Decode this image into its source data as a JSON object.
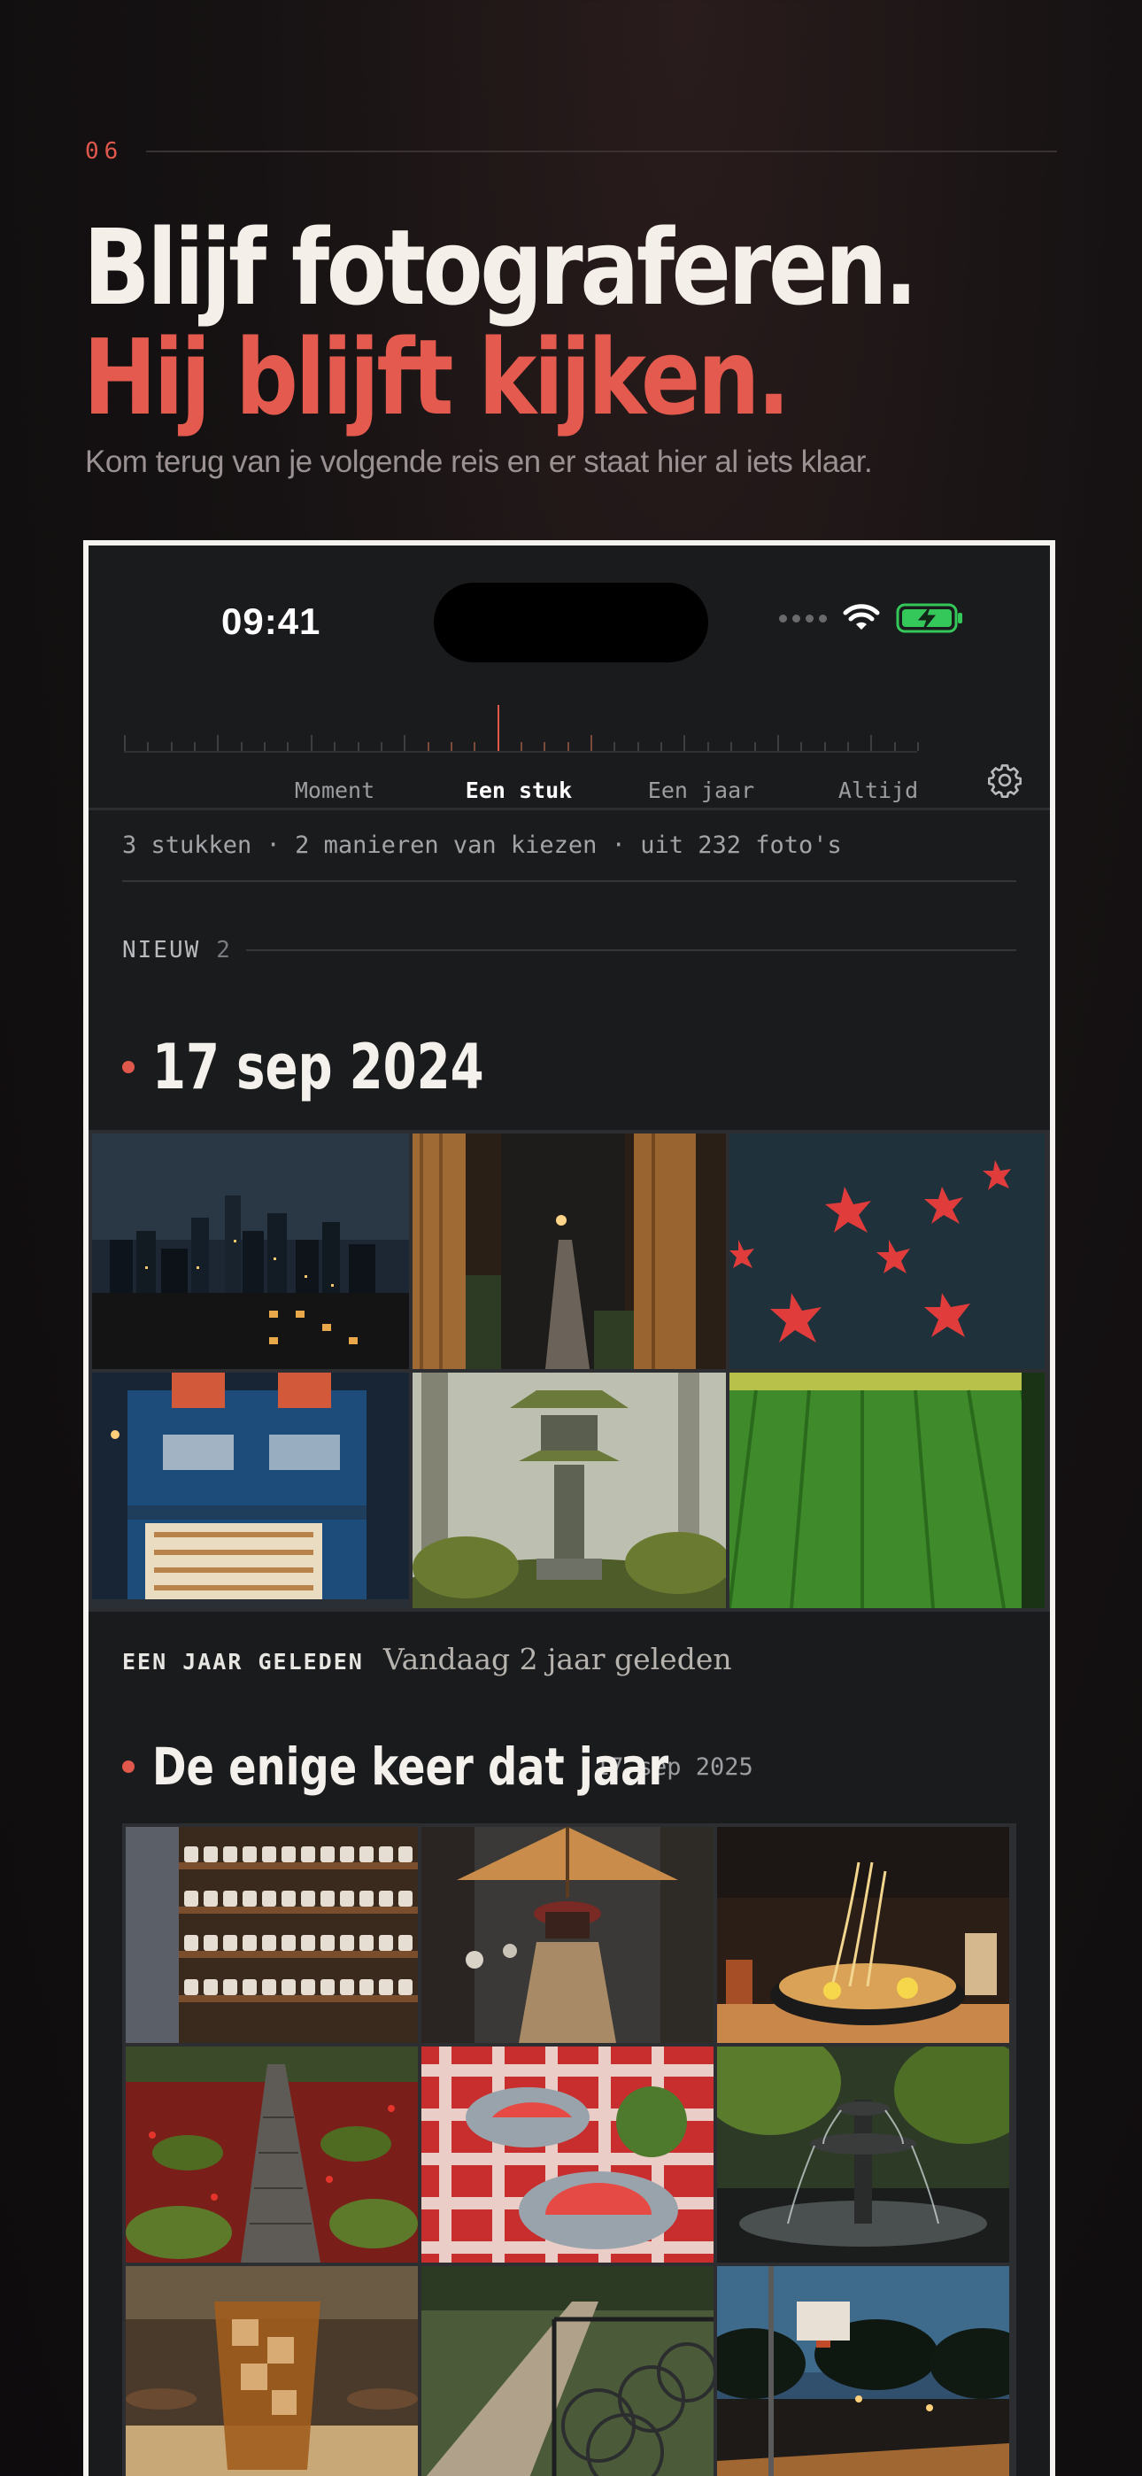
{
  "eyebrow": {
    "number": "06"
  },
  "headline": {
    "line1": "Blijf fotograferen.",
    "line2": "Hij blijft kijken.",
    "subline": "Kom terug van je volgende reis en er staat hier al iets klaar."
  },
  "status_bar": {
    "time": "09:41"
  },
  "scale": {
    "tabs": [
      {
        "label": "Moment",
        "active": false
      },
      {
        "label": "Een stuk",
        "active": true
      },
      {
        "label": "Een jaar",
        "active": false
      },
      {
        "label": "Altijd",
        "active": false
      }
    ]
  },
  "summary": "3 stukken · 2 manieren van kiezen · uit 232 foto's",
  "new_section": {
    "label": "NIEUW",
    "count": "2"
  },
  "group1": {
    "date": "17 sep 2024",
    "photos": [
      "city-night-skyline",
      "narrow-alley-lamps",
      "red-maple-leaves-water",
      "corner-convenience-store",
      "mossy-stone-lantern",
      "green-rice-field"
    ]
  },
  "memory": {
    "label": "EEN JAAR GELEDEN",
    "caption": "Vandaag 2 jaar geleden"
  },
  "group2": {
    "title": "De enige keer dat jaar",
    "date": "17 sep 2025",
    "photos": [
      "ceramic-cups-shelves",
      "umbrella-street",
      "ramen-bowl",
      "moss-path-red-leaves",
      "watermelon-picnic",
      "park-fountain",
      "iced-tea-cafe",
      "bicycles-railing",
      "basketball-court-dusk"
    ]
  },
  "colors": {
    "accent": "#e0574b",
    "background": "#161213",
    "phone_bg": "#1a1b1d",
    "battery": "#34c759"
  }
}
